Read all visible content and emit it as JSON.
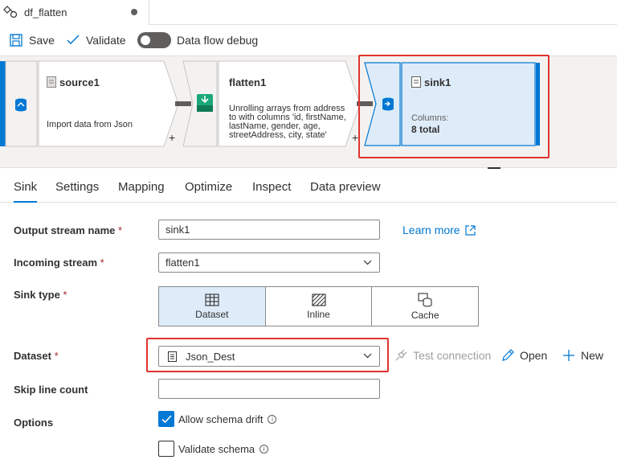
{
  "tab": {
    "title": "df_flatten",
    "unsaved_icon": "dot-icon"
  },
  "toolbar": {
    "save_label": "Save",
    "validate_label": "Validate",
    "debug_label": "Data flow debug"
  },
  "canvas": {
    "source": {
      "title": "source1",
      "description": "Import data from Json"
    },
    "flatten": {
      "title": "flatten1",
      "description_lines": [
        "Unrolling arrays from address",
        "to  with columns 'id, firstName,",
        "lastName, gender, age,",
        "streetAddress, city, state'"
      ]
    },
    "sink": {
      "title": "sink1",
      "columns_label": "Columns:",
      "columns_value": "8 total"
    },
    "plus_symbol": "+"
  },
  "tabs": [
    "Sink",
    "Settings",
    "Mapping",
    "Optimize",
    "Inspect",
    "Data preview"
  ],
  "form": {
    "output_stream": {
      "label": "Output stream name",
      "required": "*",
      "value": "sink1"
    },
    "learn_more": "Learn more",
    "incoming_stream": {
      "label": "Incoming stream",
      "required": "*",
      "value": "flatten1"
    },
    "sink_type": {
      "label": "Sink type",
      "required": "*",
      "options": [
        "Dataset",
        "Inline",
        "Cache"
      ],
      "selected": "Dataset"
    },
    "dataset": {
      "label": "Dataset",
      "required": "*",
      "value": "Json_Dest"
    },
    "actions": {
      "test_connection": "Test connection",
      "open": "Open",
      "new": "New"
    },
    "skip_line_count": {
      "label": "Skip line count",
      "value": ""
    },
    "options": {
      "label": "Options",
      "allow_schema_drift": "Allow schema drift",
      "allow_checked": true,
      "validate_schema": "Validate schema",
      "validate_checked": false
    },
    "info_glyph": "i"
  },
  "colors": {
    "accent": "#0078d4",
    "highlight": "#e0332f",
    "sink_bg": "#deecf9",
    "flatten_icon": "#1aa87a"
  }
}
